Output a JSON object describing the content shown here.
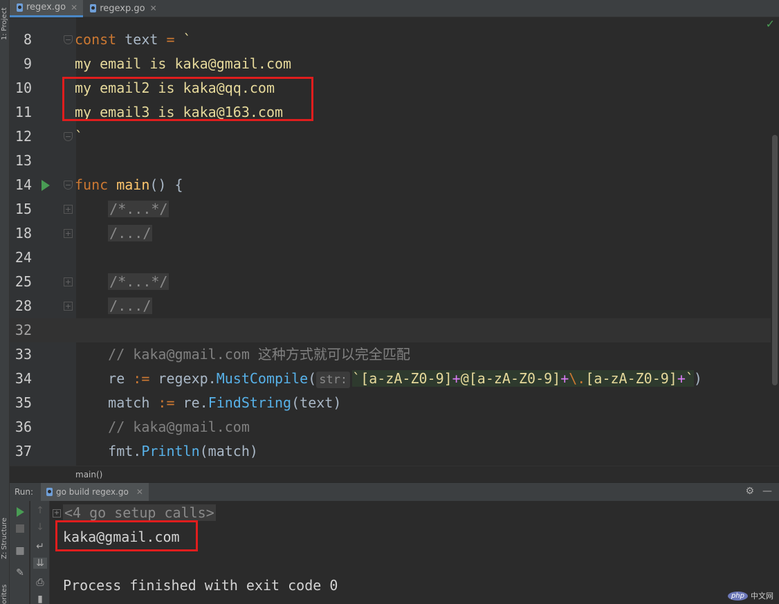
{
  "tabs": [
    {
      "label": "regex.go",
      "active": true
    },
    {
      "label": "regexp.go",
      "active": false
    }
  ],
  "left_strip": {
    "project_label": "1: Project",
    "structure_label": "Z: Structure",
    "favorites_label": "orites"
  },
  "editor": {
    "lines": [
      {
        "num": "8"
      },
      {
        "num": "9",
        "text": "my email is kaka@gmail.com"
      },
      {
        "num": "10",
        "text": "my email2 is kaka@qq.com"
      },
      {
        "num": "11",
        "text": "my email3 is kaka@163.com"
      },
      {
        "num": "12",
        "text": "`"
      },
      {
        "num": "13"
      },
      {
        "num": "14"
      },
      {
        "num": "15",
        "text": "/*...*/"
      },
      {
        "num": "18",
        "text": "/.../"
      },
      {
        "num": "24"
      },
      {
        "num": "25",
        "text": "/*...*/"
      },
      {
        "num": "28",
        "text": "/.../"
      },
      {
        "num": "32"
      },
      {
        "num": "33",
        "text": "// kaka@gmail.com 这种方式就可以完全匹配"
      },
      {
        "num": "34"
      },
      {
        "num": "35"
      },
      {
        "num": "36",
        "text": "// kaka@gmail.com"
      },
      {
        "num": "37"
      }
    ],
    "tokens": {
      "const": "const",
      "text_ident": " text ",
      "eq": "=",
      "backtick": " `",
      "func": "func",
      "main": "main",
      "main_rest": "() {",
      "re": "re ",
      "assign": ":=",
      "regexp": " regexp.",
      "must_compile": "MustCompile",
      "paren_open": "(",
      "param_hint": "str:",
      "rx_tick": "`",
      "rx_class1": "[a-zA-Z0-9]",
      "rx_plus1": "+",
      "rx_at": "@",
      "rx_class2": "[a-zA-Z0-9]",
      "rx_plus2": "+",
      "rx_dot": "\\.",
      "rx_class3": "[a-zA-Z0-9]",
      "rx_plus3": "+",
      "rx_tick_end": "`",
      "paren_close": ")",
      "match": "match ",
      "assign2": ":=",
      "re_dot": " re.",
      "find_string": "FindString",
      "find_args": "(text)",
      "fmt": "fmt.",
      "println": "Println",
      "println_args": "(match)"
    }
  },
  "breadcrumb": "main()",
  "run_panel": {
    "label": "Run:",
    "tab_label": "go build regex.go",
    "output_lines": [
      "<4 go setup calls>",
      "kaka@gmail.com",
      "",
      "Process finished with exit code 0"
    ]
  },
  "watermark": {
    "php": "php",
    "site": "中文网"
  },
  "colors": {
    "highlight_box": "#e01d1d",
    "keyword": "#cc7832",
    "string": "#e6d99b",
    "function": "#ffc66d",
    "method": "#57b1e8",
    "comment": "#808080",
    "run_green": "#499c54"
  }
}
